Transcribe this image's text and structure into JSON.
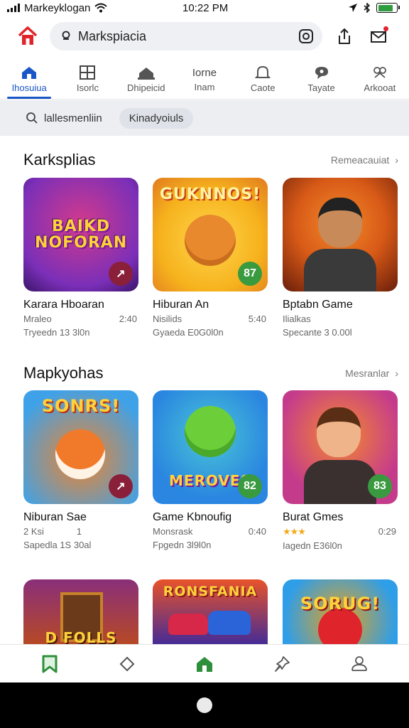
{
  "status": {
    "carrier": "Markeyklogan",
    "time": "10:22 PM"
  },
  "search": {
    "value": "Markspiacia"
  },
  "tabs": [
    {
      "label": "Ihosuiua",
      "icon": "home-icon"
    },
    {
      "label": "Isorlc",
      "icon": "grid-icon"
    },
    {
      "label": "Dhipeicid",
      "icon": "store-icon"
    },
    {
      "label": "Inam",
      "icon": "text-icon",
      "top": "Iorne"
    },
    {
      "label": "Caote",
      "icon": "bell-icon"
    },
    {
      "label": "Tayate",
      "icon": "chat-icon"
    },
    {
      "label": "Arkooat",
      "icon": "puzzle-icon"
    }
  ],
  "filter": {
    "search_label": "lallesmenliin",
    "chip_label": "Kinadyoiuls"
  },
  "sections": [
    {
      "title": "Karksplias",
      "more": "Remeacauiat",
      "cards": [
        {
          "name": "Karara Hboaran",
          "sub": "Mraleo",
          "rating": "2:40",
          "meta": "Tryeedn 13 3l0n",
          "art": "BAIKD NOFORAN",
          "badge": "",
          "bg1": "#7b2fb8",
          "bg2": "#d23a8c"
        },
        {
          "name": "Hiburan An",
          "sub": "Nisilids",
          "rating": "5:40",
          "meta": "Gyaeda E0G0l0n",
          "art": "GUKNNOS!",
          "badge": "87",
          "bg1": "#f6b21d",
          "bg2": "#e85f2a"
        },
        {
          "name": "Bptabn Game",
          "sub": "Ilialkas",
          "rating": "",
          "meta": "Specante 3 0.00l",
          "art": "",
          "badge": "",
          "bg1": "#d85a17",
          "bg2": "#6a1e0a"
        }
      ]
    },
    {
      "title": "Mapkyohas",
      "more": "Mesranlar",
      "cards": [
        {
          "name": "Niburan Sae",
          "sub": "2 Ksi",
          "rating": "1",
          "meta": "Sapedla 1S 30al",
          "art": "SONRS!",
          "badge": "",
          "bg1": "#3fa2e8",
          "bg2": "#f0832c"
        },
        {
          "name": "Game Kbnoufig",
          "sub": "Monsrask",
          "rating": "0:40",
          "meta": "Fpgedn 3l9l0n",
          "art": "MEROVES",
          "badge": "82",
          "bg1": "#2a86e0",
          "bg2": "#49c6d6"
        },
        {
          "name": "Burat Gmes",
          "sub": "",
          "rating": "0:29",
          "meta": "Iagedn E36l0n",
          "art": "",
          "badge": "83",
          "stars": "★★★",
          "bg1": "#c53b8c",
          "bg2": "#f58a2c"
        }
      ]
    },
    {
      "cards": [
        {
          "art": "D FOLLS",
          "bg1": "#b84a22",
          "bg2": "#8a2f7a"
        },
        {
          "art": "RONSFANIA",
          "bg1": "#3f2a9a",
          "bg2": "#e8522a"
        },
        {
          "art": "SORUG!",
          "bg1": "#e8a21a",
          "bg2": "#2f9ee8"
        }
      ]
    }
  ],
  "colors": {
    "accent": "#1a56c8",
    "brand_red": "#e0242c",
    "green": "#2e8f3a",
    "badge_green": "#3a9a3f",
    "badge_dark": "#8a1f3a"
  }
}
